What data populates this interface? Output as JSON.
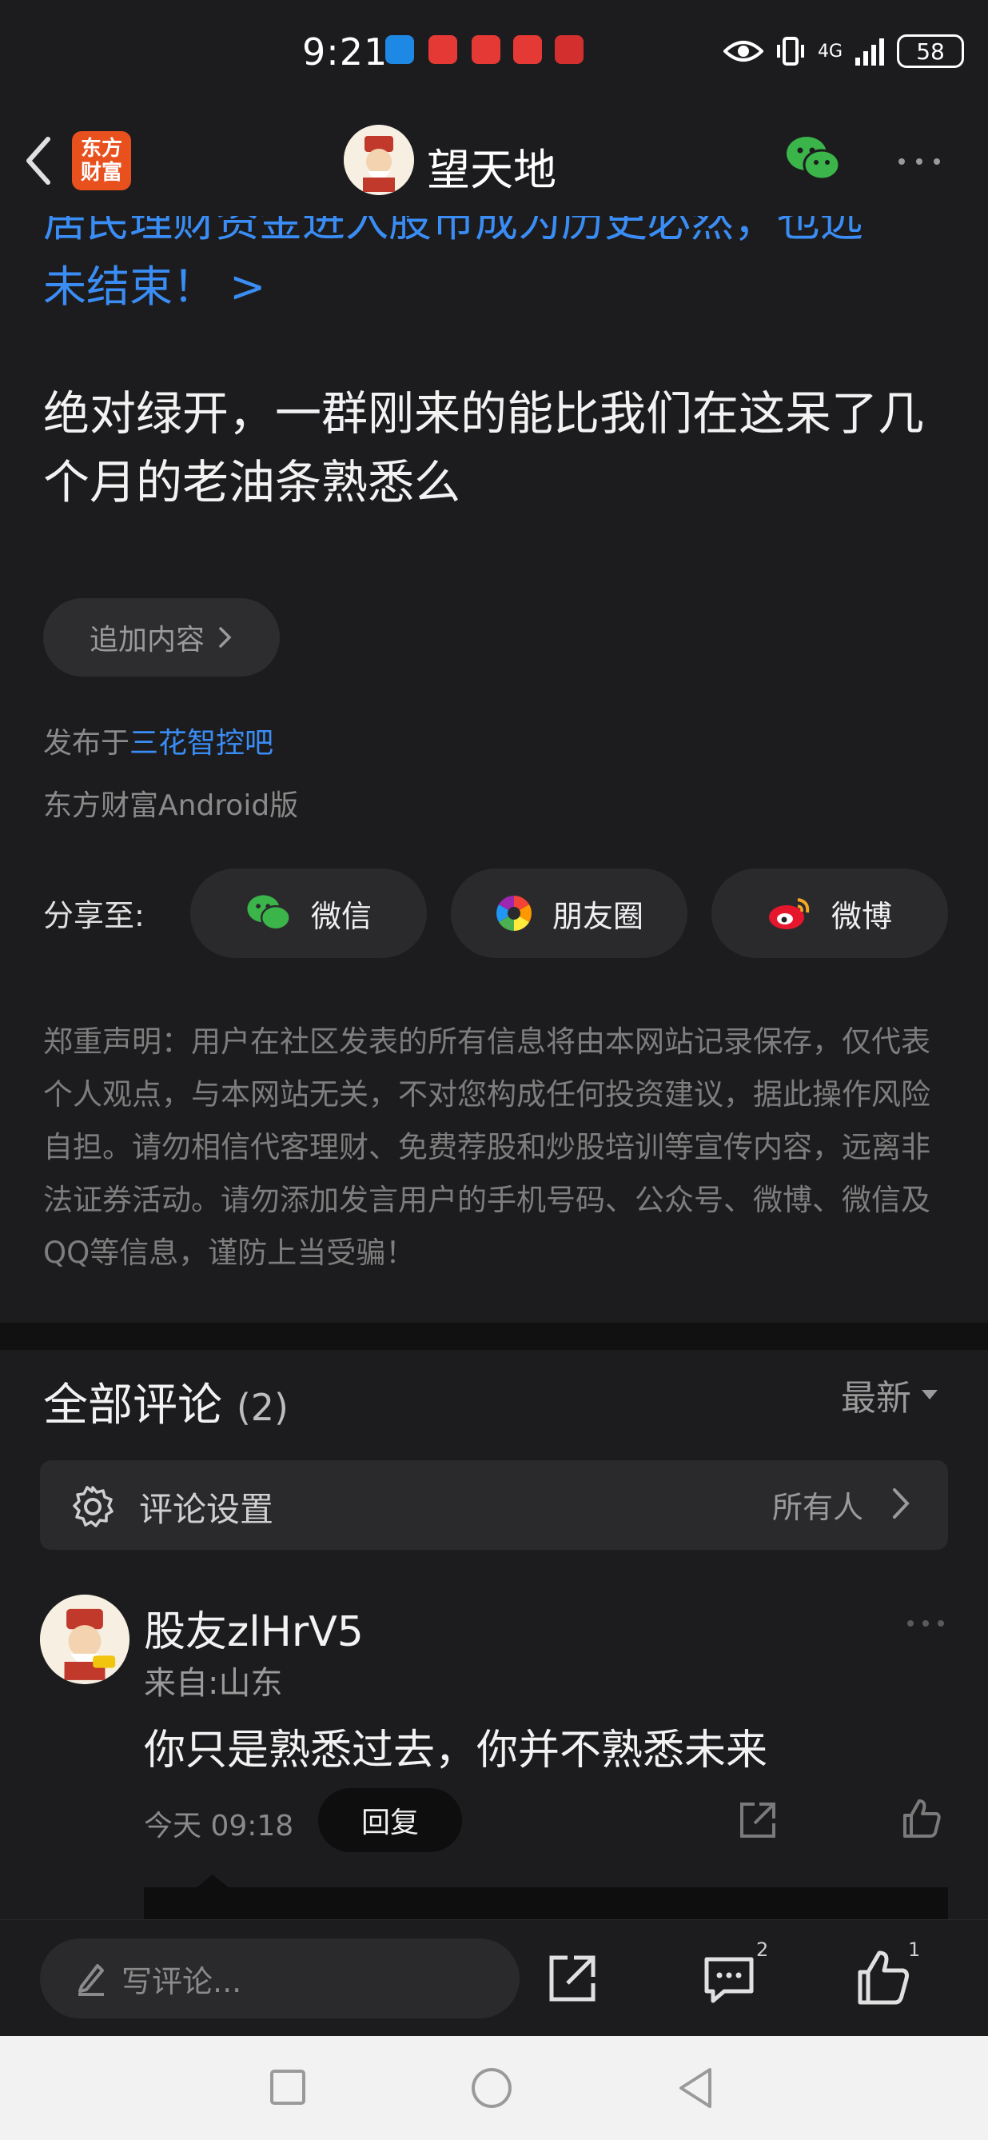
{
  "status_bar": {
    "time": "9:21",
    "network": "4G",
    "battery": "58"
  },
  "header": {
    "back_label": "back",
    "app_logo_line1": "东方",
    "app_logo_line2": "财富",
    "title": "望天地"
  },
  "article": {
    "link_line1": "居民理财资金进入股市成为历史必然，也远",
    "link_line2": "未结束！ >",
    "post_text": "绝对绿开，一群刚来的能比我们在这呆了几个月的老油条熟悉么",
    "add_content": "追加内容",
    "published_prefix": "发布于",
    "published_bar": "三花智控吧",
    "client": "东方财富Android版"
  },
  "share": {
    "label": "分享至:",
    "wechat": "微信",
    "moments": "朋友圈",
    "weibo": "微博"
  },
  "disclaimer": "郑重声明：用户在社区发表的所有信息将由本网站记录保存，仅代表个人观点，与本网站无关，不对您构成任何投资建议，据此操作风险自担。请勿相信代客理财、免费荐股和炒股培训等宣传内容，远离非法证券活动。请勿添加发言用户的手机号码、公众号、微博、微信及QQ等信息，谨防上当受骗！",
  "comments": {
    "title": "全部评论",
    "count": "(2)",
    "sort": "最新",
    "settings_label": "评论设置",
    "settings_value": "所有人",
    "items": [
      {
        "user": "股友zlHrV5",
        "location": "来自:山东",
        "text": "你只是熟悉过去，你并不熟悉未来",
        "time": "今天 09:18",
        "reply": "回复"
      }
    ]
  },
  "bottom_bar": {
    "write_placeholder": "写评论...",
    "comment_count": "2",
    "like_count": "1"
  },
  "icons": {
    "status": [
      "eye-icon",
      "vibrate-icon",
      "signal-icon",
      "battery-icon"
    ],
    "header": [
      "back-arrow-icon",
      "wechat-icon",
      "more-icon"
    ],
    "share": [
      "wechat-icon",
      "moments-icon",
      "weibo-icon"
    ],
    "comment": [
      "gear-icon",
      "chevron-right-icon",
      "share-icon",
      "like-icon"
    ],
    "bottom": [
      "pencil-icon",
      "share-icon",
      "comment-icon",
      "like-icon"
    ],
    "nav": [
      "square-icon",
      "circle-icon",
      "triangle-back-icon"
    ]
  },
  "colors": {
    "background": "#1c1c1e",
    "link": "#3a8df5",
    "brand": "#e8501e",
    "wechat": "#3bb44a"
  }
}
